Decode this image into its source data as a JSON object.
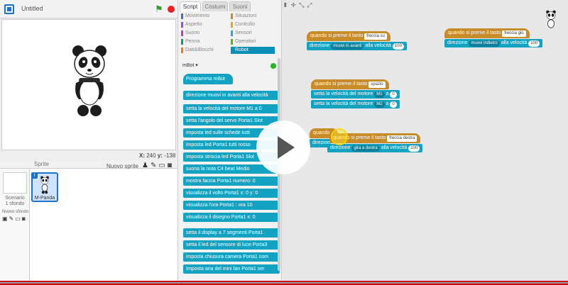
{
  "stage": {
    "title": "Untitled",
    "x_label": "X:",
    "x_value": "240",
    "y_label": "y:",
    "y_value": "-138"
  },
  "sprites": {
    "header": "Sprite",
    "new_sprite": "Nuovo sprite",
    "scene_name": "Scenario",
    "scene_count": "1 sfondo",
    "new_background": "Nuovo sfondo",
    "sprite_name": "M-Panda",
    "info": "i"
  },
  "palette": {
    "tabs": [
      "Script",
      "Costumi",
      "Suoni"
    ],
    "categories": [
      "Movimento",
      "Situazioni",
      "Aspetto",
      "Controllo",
      "Suono",
      "Sensori",
      "Penna",
      "Operatori",
      "Dati&Blocchi",
      "Robot"
    ],
    "category_colors": [
      "#4a6cd4",
      "#c88b29",
      "#8a55d7",
      "#e1a91a",
      "#bb42c3",
      "#2ca5e2",
      "#0e9a6c",
      "#5cb712",
      "#ee7d16",
      "#0b8fb8"
    ],
    "extension": "mBot",
    "blocks": [
      "Programma mBot",
      "direzione muovi in avanti alla velocità",
      "setta la velocità del motore M1 a 0",
      "setta l'angolo del servo Porta1 Slot",
      "imposta led sulle schede tutti",
      "imposta led Porta1 tutti rosso",
      "imposta striscia led Porta1 Slot",
      "suona la nota C4 beat Medio",
      "mostra faccia Porta1 numero: 0",
      "visualizza il volto Porta1 x: 0 y: 0",
      "visualizza l'ora Porta1 : ora 10",
      "visualizza il disegno Porta1 x: 0",
      "setta il display a 7 segmenti Porta1",
      "setta il led del sensore di luce Porta3",
      "imposta chiusura camera Porta1 com",
      "Imposta aria del mini fan Porta1 ser"
    ]
  },
  "scripts": {
    "s1": {
      "hat": "quando si preme il tasto",
      "key": "freccia su",
      "cmd": "direzione",
      "dir": "muovi in avanti",
      "speed_label": "alla velocità",
      "speed": "100"
    },
    "s2": {
      "hat": "quando si preme il tasto",
      "key": "freccia giù",
      "cmd": "direzione",
      "dir": "muovi indietro",
      "speed_label": "alla velocità",
      "speed": "100"
    },
    "s3": {
      "hat": "quando si preme il tasto",
      "key": "spazio",
      "cmd1": "setta la velocità del motore",
      "m1": "M1",
      "a": "a",
      "v1": "0",
      "m2": "M2",
      "v2": "0"
    },
    "s4": {
      "hat_left": "quando",
      "cmd_left": "direzione",
      "hat": "quando si preme il tasto",
      "key": "freccia destra",
      "cmd": "direzione",
      "dir": "gira a destra",
      "speed_label": "alla velocità",
      "speed": "100"
    }
  },
  "colors": {
    "motion": "#13a2c2",
    "event": "#c88b29",
    "accent": "#1c72c4"
  }
}
